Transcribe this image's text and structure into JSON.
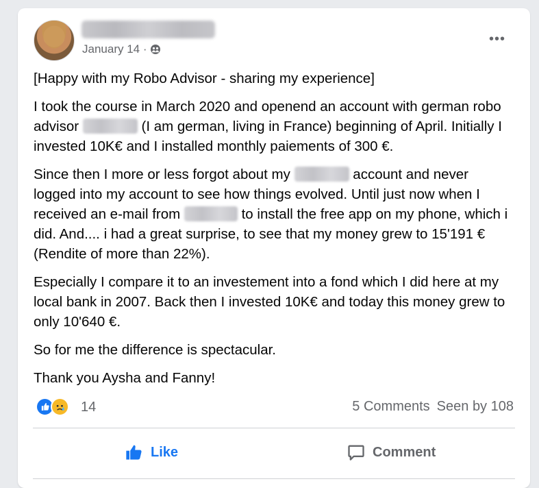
{
  "post": {
    "date": "January 14 ·",
    "privacy_icon": "friends-icon",
    "more_label": "•••",
    "paragraphs": {
      "p1": "[Happy with my Robo Advisor - sharing my experience]",
      "p2a": "I took the course in March 2020 and openend an account with german robo advisor",
      "p2b": "(I am german, living in France) beginning of April. Initially I invested 10K€ and I installed monthly paiements of 300 €.",
      "p3a": "Since then I more or less forgot about my",
      "p3b": "account and never logged into my account to see how things evolved. Until just now when I received an e-mail from",
      "p3c": "to install the free app on my phone, which i did. And.... i had a great surprise, to see that my money grew to 15'191 € (Rendite of more than 22%).",
      "p4": "Especially I compare it to an investement into a fond which I did here at my local bank in 2007. Back then I invested 10K€ and today this money grew to only 10'640 €.",
      "p5": "So for me the difference is spectacular.",
      "p6": "Thank you Aysha and Fanny!"
    }
  },
  "footer": {
    "reaction_count": "14",
    "comments": "5 Comments",
    "seen": "Seen by 108",
    "like_label": "Like",
    "comment_label": "Comment"
  },
  "colors": {
    "accent": "#1877f2",
    "muted": "#65676b"
  }
}
